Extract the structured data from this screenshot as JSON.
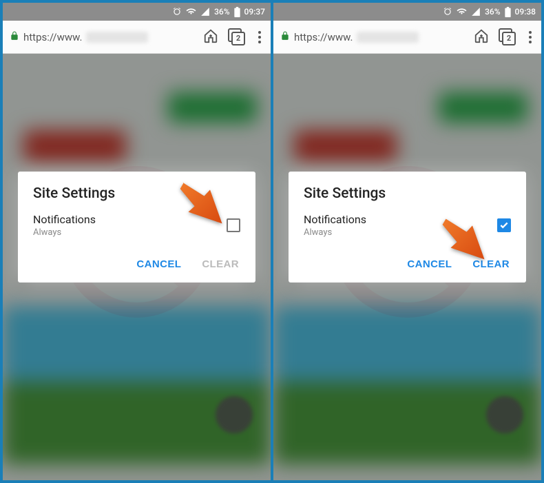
{
  "panels": [
    {
      "statusbar": {
        "battery_pct": "36%",
        "time": "09:37"
      },
      "urlbar": {
        "prefix": "https://www.",
        "tab_count": "2"
      },
      "dialog": {
        "title": "Site Settings",
        "item_label": "Notifications",
        "item_sub": "Always",
        "checked": false,
        "cancel": "CANCEL",
        "clear": "CLEAR",
        "clear_enabled": false
      },
      "arrow_target": "checkbox"
    },
    {
      "statusbar": {
        "battery_pct": "36%",
        "time": "09:38"
      },
      "urlbar": {
        "prefix": "https://www.",
        "tab_count": "2"
      },
      "dialog": {
        "title": "Site Settings",
        "item_label": "Notifications",
        "item_sub": "Always",
        "checked": true,
        "cancel": "CANCEL",
        "clear": "CLEAR",
        "clear_enabled": true
      },
      "arrow_target": "clear"
    }
  ],
  "colors": {
    "accent": "#1e88e5",
    "arrow": "#e65a17"
  }
}
